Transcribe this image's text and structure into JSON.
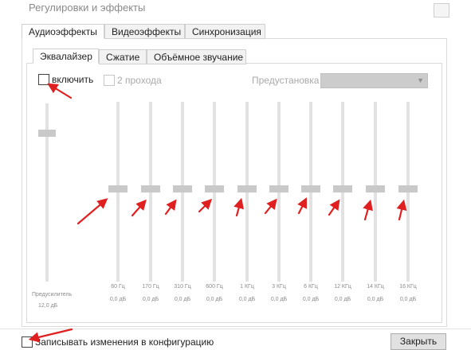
{
  "window": {
    "title": "Регулировки и эффекты"
  },
  "main_tabs": [
    {
      "label": "Аудиоэффекты",
      "active": true
    },
    {
      "label": "Видеоэффекты",
      "active": false
    },
    {
      "label": "Синхронизация",
      "active": false
    }
  ],
  "sub_tabs": [
    {
      "label": "Эквалайзер",
      "active": true
    },
    {
      "label": "Сжатие",
      "active": false
    },
    {
      "label": "Объёмное звучание",
      "active": false
    }
  ],
  "equalizer": {
    "enable_label": "включить",
    "enable_checked": false,
    "two_pass_label": "2 прохода",
    "two_pass_checked": false,
    "preset_label": "Предустановка",
    "preset_value": "",
    "preamp": {
      "label": "Предусилитель",
      "value": "12,0 дБ"
    },
    "bands": [
      {
        "freq": "60 Гц",
        "value": "0,0 дБ"
      },
      {
        "freq": "170 Гц",
        "value": "0,0 дБ"
      },
      {
        "freq": "310 Гц",
        "value": "0,0 дБ"
      },
      {
        "freq": "600 Гц",
        "value": "0,0 дБ"
      },
      {
        "freq": "1 КГц",
        "value": "0,0 дБ"
      },
      {
        "freq": "3 КГц",
        "value": "0,0 дБ"
      },
      {
        "freq": "6 КГц",
        "value": "0,0 дБ"
      },
      {
        "freq": "12 КГц",
        "value": "0,0 дБ"
      },
      {
        "freq": "14 КГц",
        "value": "0,0 дБ"
      },
      {
        "freq": "16 КГц",
        "value": "0,0 дБ"
      }
    ]
  },
  "footer": {
    "save_config_label": "Записывать изменения в конфигурацию",
    "save_config_checked": false,
    "close_label": "Закрыть"
  },
  "annotation_color": "#e02020"
}
